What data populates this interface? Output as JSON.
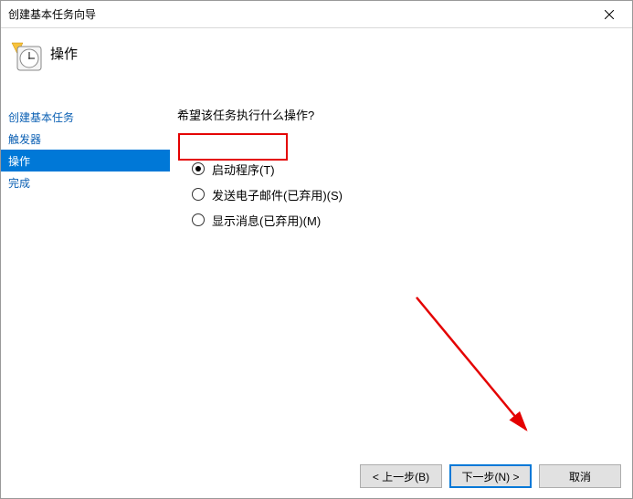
{
  "window": {
    "title": "创建基本任务向导"
  },
  "header": {
    "page_title": "操作"
  },
  "sidebar": {
    "items": [
      {
        "label": "创建基本任务",
        "selected": false
      },
      {
        "label": "触发器",
        "selected": false
      },
      {
        "label": "操作",
        "selected": true
      },
      {
        "label": "完成",
        "selected": false
      }
    ]
  },
  "content": {
    "question": "希望该任务执行什么操作?",
    "options": [
      {
        "label": "启动程序(T)",
        "checked": true
      },
      {
        "label": "发送电子邮件(已弃用)(S)",
        "checked": false
      },
      {
        "label": "显示消息(已弃用)(M)",
        "checked": false
      }
    ]
  },
  "footer": {
    "back": "< 上一步(B)",
    "next": "下一步(N) >",
    "cancel": "取消"
  }
}
